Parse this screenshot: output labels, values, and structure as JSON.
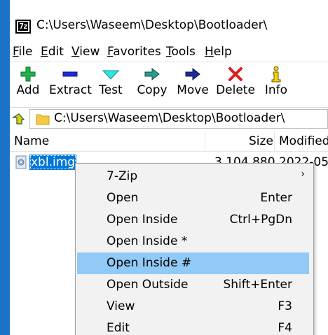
{
  "window": {
    "title": "C:\\Users\\Waseem\\Desktop\\Bootloader\\",
    "app_icon_text": "7z"
  },
  "menubar": [
    {
      "accel": "F",
      "rest": "ile"
    },
    {
      "accel": "E",
      "rest": "dit"
    },
    {
      "accel": "V",
      "rest": "iew"
    },
    {
      "accel": "F",
      "rest": "avorites",
      "pre": ""
    },
    {
      "accel": "T",
      "rest": "ools"
    },
    {
      "accel": "H",
      "rest": "elp"
    }
  ],
  "toolbar": {
    "add": "Add",
    "extract": "Extract",
    "test": "Test",
    "copy": "Copy",
    "move": "Move",
    "delete": "Delete",
    "info": "Info"
  },
  "address": {
    "path": "C:\\Users\\Waseem\\Desktop\\Bootloader\\"
  },
  "columns": {
    "name": "Name",
    "size": "Size",
    "modified": "Modified"
  },
  "files": [
    {
      "name": "xbl.img",
      "size": "3 104 880",
      "modified": "2022-05-"
    }
  ],
  "context_menu": {
    "items": [
      {
        "label": "7-Zip",
        "shortcut": "",
        "submenu": true
      },
      {
        "label": "Open",
        "shortcut": "Enter"
      },
      {
        "label": "Open Inside",
        "shortcut": "Ctrl+PgDn"
      },
      {
        "label": "Open Inside *",
        "shortcut": ""
      },
      {
        "label": "Open Inside #",
        "shortcut": "",
        "highlighted": true
      },
      {
        "label": "Open Outside",
        "shortcut": "Shift+Enter"
      },
      {
        "label": "View",
        "shortcut": "F3"
      },
      {
        "label": "Edit",
        "shortcut": "F4"
      }
    ],
    "submenu_arrow": "›"
  },
  "colors": {
    "selection": "#0078d7",
    "menu_highlight": "#91c9f7",
    "menu_bg": "#f2f2f2",
    "desktop": "#1a73c9"
  }
}
